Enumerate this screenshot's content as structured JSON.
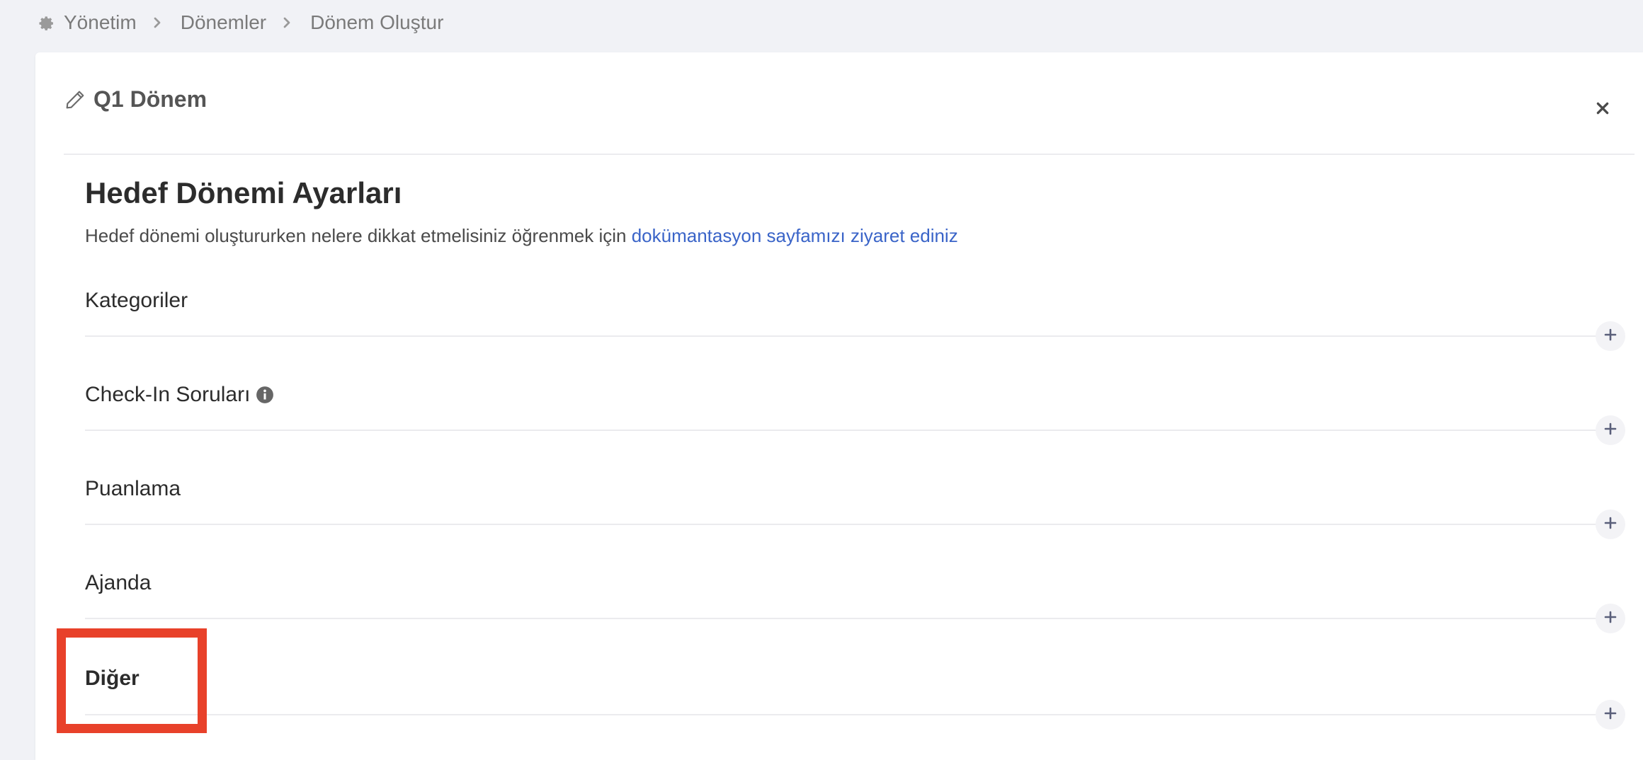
{
  "breadcrumb": {
    "items": [
      "Yönetim",
      "Dönemler",
      "Dönem Oluştur"
    ]
  },
  "card": {
    "title": "Q1 Dönem",
    "close_label": "×"
  },
  "settings": {
    "title": "Hedef Dönemi Ayarları",
    "description": "Hedef dönemi oluştururken nelere dikkat etmelisiniz öğrenmek için ",
    "doc_link": "dokümantasyon sayfamızı ziyaret ediniz"
  },
  "groups": [
    {
      "label": "Kategoriler"
    },
    {
      "label": "Check-In Soruları"
    },
    {
      "label": "Puanlama"
    },
    {
      "label": "Ajanda"
    },
    {
      "label": "Diğer"
    }
  ],
  "colors": {
    "background": "#f1f2f6",
    "link": "#3a64c8",
    "highlight": "#e8412a"
  },
  "icons": {
    "breadcrumb_root": "gear-icon",
    "separator": "chevron-right-icon",
    "title": "pencil-icon",
    "close": "close-icon",
    "info": "info-icon",
    "add": "plus-icon"
  }
}
